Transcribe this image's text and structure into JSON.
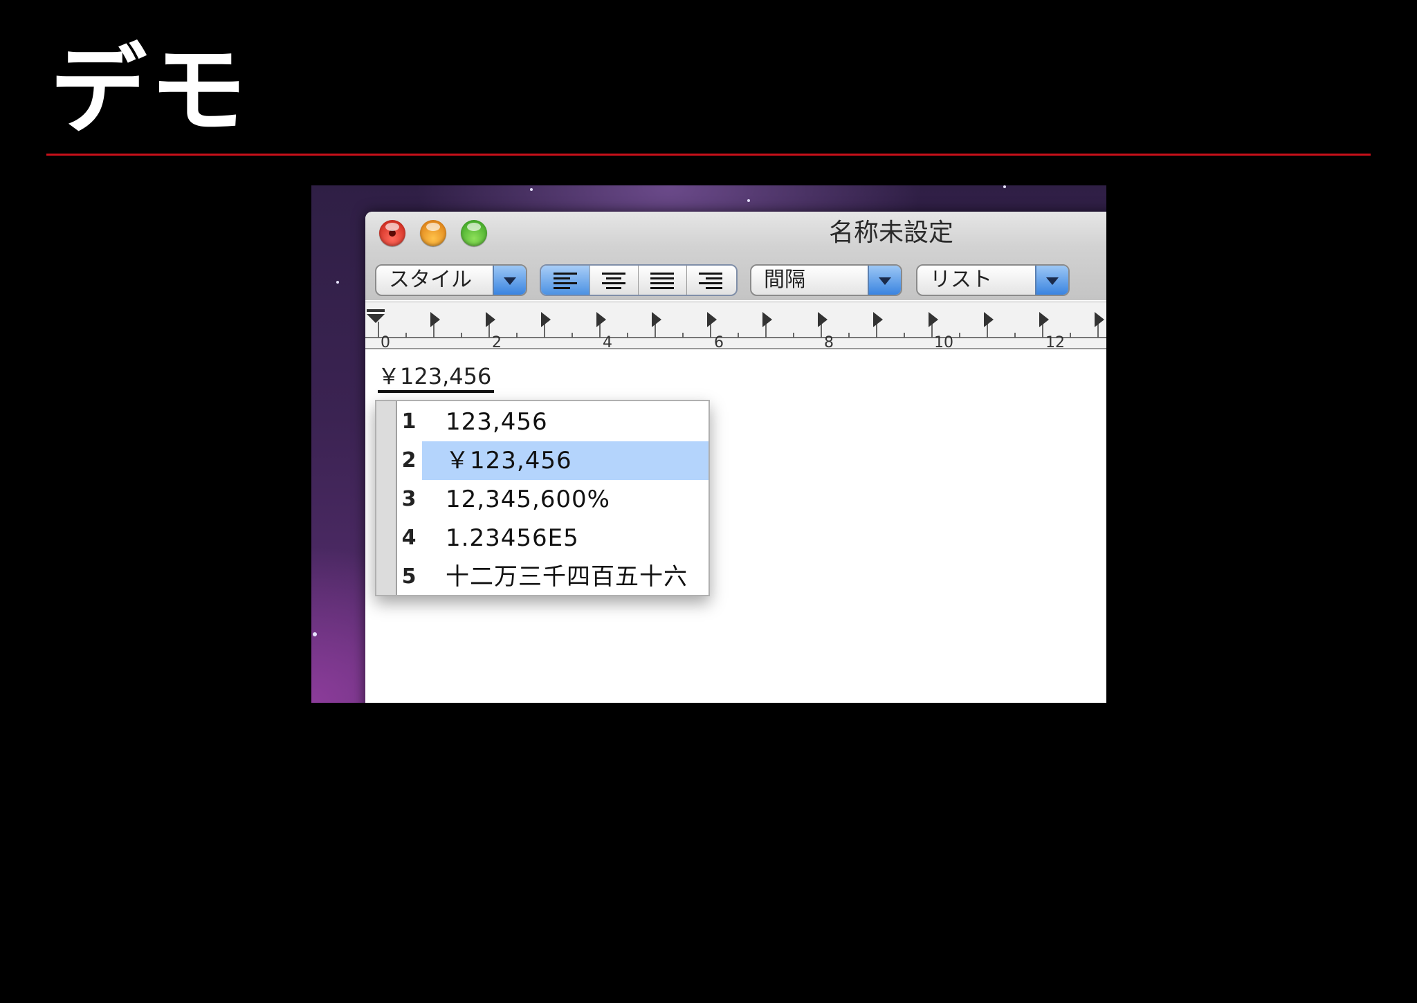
{
  "slide": {
    "title": "デモ"
  },
  "window": {
    "title": "名称未設定",
    "toolbar": {
      "style_dropdown": "スタイル",
      "spacing_dropdown": "間隔",
      "list_dropdown": "リスト"
    },
    "ruler": {
      "labels": [
        "0",
        "2",
        "4",
        "6",
        "8",
        "10",
        "12"
      ]
    },
    "document_text": "￥123,456",
    "candidates": [
      {
        "num": "1",
        "text": "123,456"
      },
      {
        "num": "2",
        "text": "￥123,456"
      },
      {
        "num": "3",
        "text": "12,345,600%"
      },
      {
        "num": "4",
        "text": "1.23456E5"
      },
      {
        "num": "5",
        "text": "十二万三千四百五十六"
      }
    ],
    "selected_candidate": "2"
  },
  "icons": {
    "close": "close-button-icon",
    "minimize": "minimize-button-icon",
    "zoom": "zoom-button-icon",
    "align_left": "align-left-icon",
    "align_center": "align-center-icon",
    "align_justify": "align-justify-icon",
    "align_right": "align-right-icon"
  },
  "colors": {
    "title_rule": "#c8101a",
    "selection": "#b4d4fc",
    "aqua_blue": "#3a84e0"
  }
}
